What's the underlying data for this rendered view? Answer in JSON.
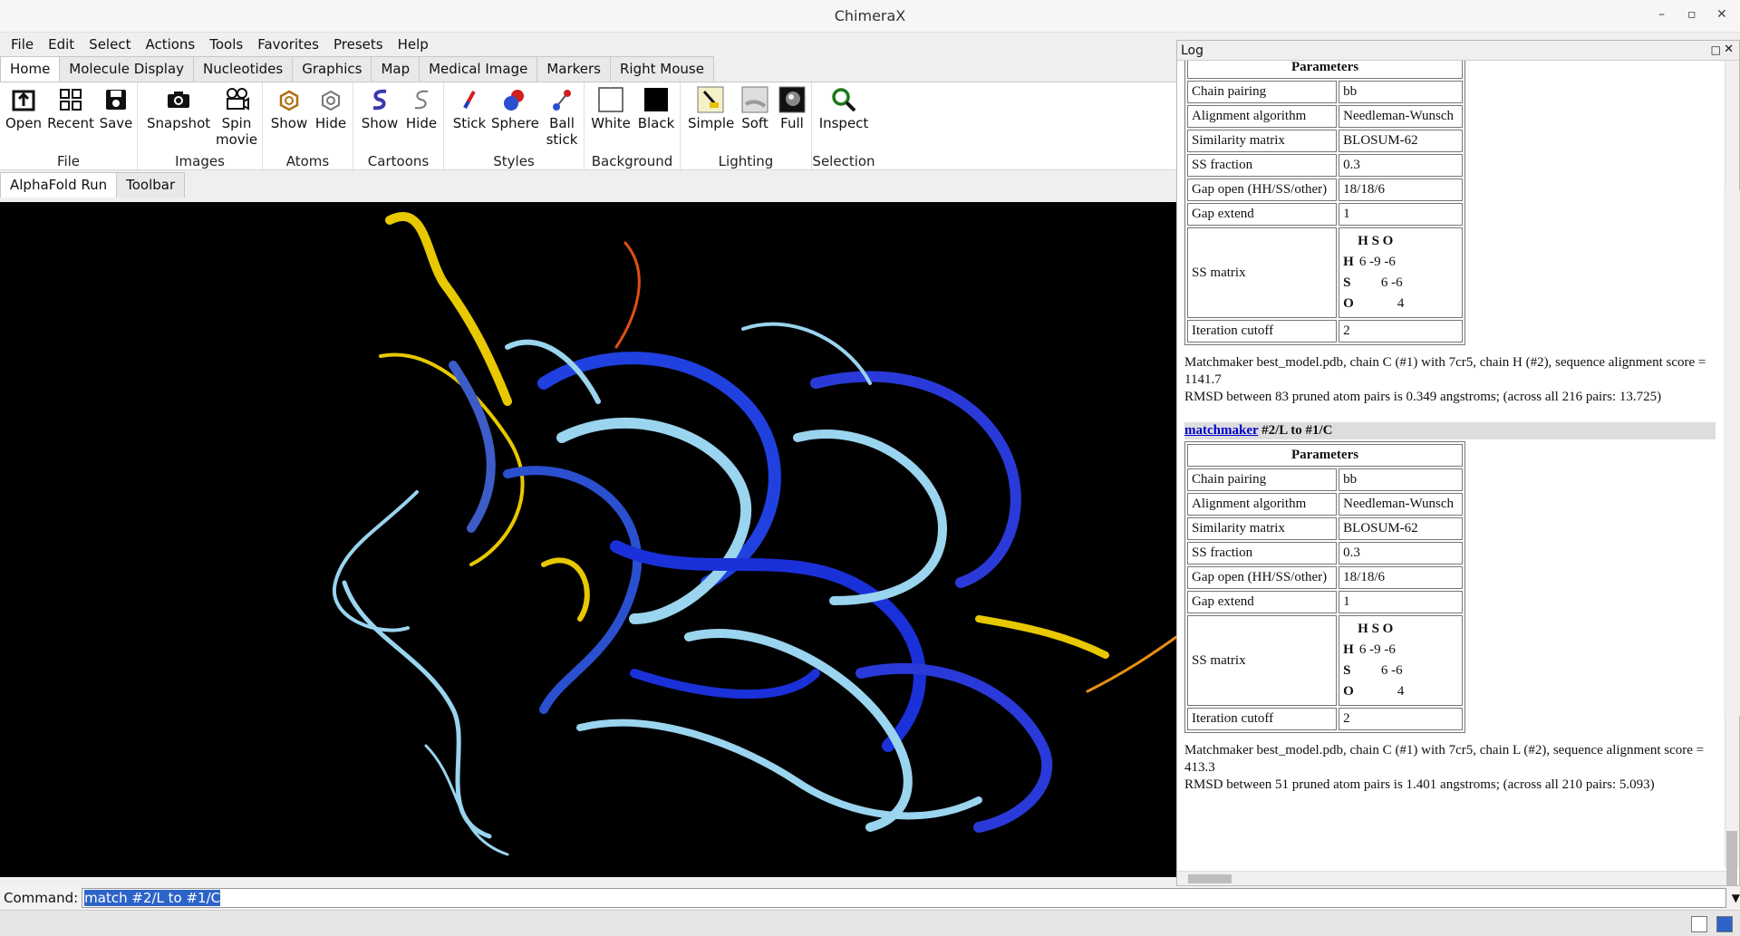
{
  "window": {
    "title": "ChimeraX"
  },
  "menu": [
    "File",
    "Edit",
    "Select",
    "Actions",
    "Tools",
    "Favorites",
    "Presets",
    "Help"
  ],
  "tabs": [
    "Home",
    "Molecule Display",
    "Nucleotides",
    "Graphics",
    "Map",
    "Medical Image",
    "Markers",
    "Right Mouse"
  ],
  "ribbon": {
    "groups": [
      {
        "name": "File",
        "buttons": [
          "Open",
          "Recent",
          "Save"
        ]
      },
      {
        "name": "Images",
        "buttons": [
          "Snapshot",
          "Spin movie"
        ]
      },
      {
        "name": "Atoms",
        "buttons": [
          "Show",
          "Hide"
        ]
      },
      {
        "name": "Cartoons",
        "buttons": [
          "Show",
          "Hide"
        ]
      },
      {
        "name": "Styles",
        "buttons": [
          "Stick",
          "Sphere",
          "Ball stick"
        ]
      },
      {
        "name": "Background",
        "buttons": [
          "White",
          "Black"
        ]
      },
      {
        "name": "Lighting",
        "buttons": [
          "Simple",
          "Soft",
          "Full"
        ]
      },
      {
        "name": "Selection",
        "buttons": [
          "Inspect"
        ]
      }
    ]
  },
  "subtabs": [
    "AlphaFold Run",
    "Toolbar"
  ],
  "log": {
    "title": "Log",
    "params_header": "Parameters",
    "block1": {
      "rows": [
        [
          "Chain pairing",
          "bb"
        ],
        [
          "Alignment algorithm",
          "Needleman-Wunsch"
        ],
        [
          "Similarity matrix",
          "BLOSUM-62"
        ],
        [
          "SS fraction",
          "0.3"
        ],
        [
          "Gap open (HH/SS/other)",
          "18/18/6"
        ],
        [
          "Gap extend",
          "1"
        ]
      ],
      "ss_label": "SS matrix",
      "iter_label": "Iteration cutoff",
      "iter_value": "2",
      "text1": "Matchmaker best_model.pdb, chain C (#1) with 7cr5, chain H (#2), sequence alignment score = 1141.7",
      "text2": "RMSD between 83 pruned atom pairs is 0.349 angstroms; (across all 216 pairs: 13.725)"
    },
    "command": {
      "link": "matchmaker",
      "rest": " #2/L to #1/C"
    },
    "block2": {
      "rows": [
        [
          "Chain pairing",
          "bb"
        ],
        [
          "Alignment algorithm",
          "Needleman-Wunsch"
        ],
        [
          "Similarity matrix",
          "BLOSUM-62"
        ],
        [
          "SS fraction",
          "0.3"
        ],
        [
          "Gap open (HH/SS/other)",
          "18/18/6"
        ],
        [
          "Gap extend",
          "1"
        ]
      ],
      "ss_label": "SS matrix",
      "iter_label": "Iteration cutoff",
      "iter_value": "2",
      "text1": "Matchmaker best_model.pdb, chain C (#1) with 7cr5, chain L (#2), sequence alignment score = 413.3",
      "text2": "RMSD between 51 pruned atom pairs is 1.401 angstroms; (across all 210 pairs: 5.093)"
    },
    "ss_matrix": {
      "header": "H S O",
      "rows": [
        [
          "H",
          "6 -9 -6"
        ],
        [
          "S",
          "6 -6"
        ],
        [
          "O",
          "4"
        ]
      ]
    }
  },
  "command_line": {
    "label": "Command:",
    "value": "match #2/L to #1/C"
  },
  "colors": {
    "accent": "#2d64c8",
    "viewer_bg": "#000000"
  }
}
